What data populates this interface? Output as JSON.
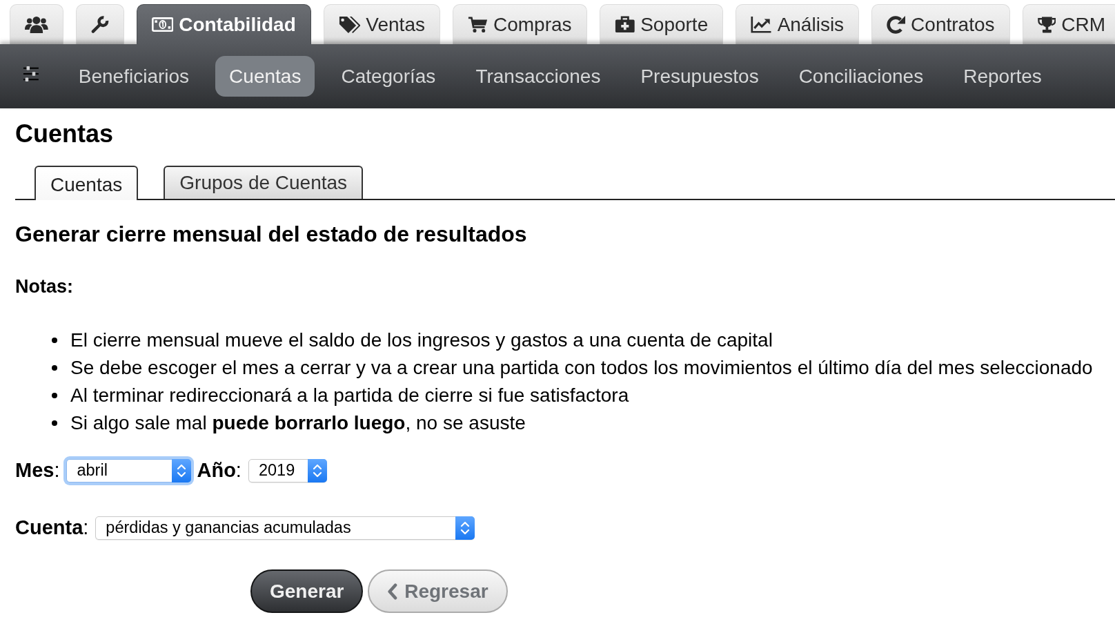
{
  "module_tabs": [
    {
      "selected": false
    },
    {
      "selected": false
    },
    {
      "label": "Contabilidad",
      "selected": true
    },
    {
      "label": "Ventas",
      "selected": false
    },
    {
      "label": "Compras",
      "selected": false
    },
    {
      "label": "Soporte",
      "selected": false
    },
    {
      "label": "Análisis",
      "selected": false
    },
    {
      "label": "Contratos",
      "selected": false
    },
    {
      "label": "CRM",
      "selected": false
    }
  ],
  "nav_items": [
    {
      "label": "Beneficiarios",
      "selected": false
    },
    {
      "label": "Cuentas",
      "selected": true
    },
    {
      "label": "Categorías",
      "selected": false
    },
    {
      "label": "Transacciones",
      "selected": false
    },
    {
      "label": "Presupuestos",
      "selected": false
    },
    {
      "label": "Conciliaciones",
      "selected": false
    },
    {
      "label": "Reportes",
      "selected": false
    }
  ],
  "page_title": "Cuentas",
  "sub_tabs": [
    {
      "label": "Cuentas",
      "selected": true
    },
    {
      "label": "Grupos de Cuentas",
      "selected": false
    }
  ],
  "section_title": "Generar cierre mensual del estado de resultados",
  "notes": {
    "title": "Notas:",
    "items": [
      "El cierre mensual mueve el saldo de los ingresos y gastos a una cuenta de capital",
      "Se debe escoger el mes a cerrar y va a crear una partida con todos los movimientos el último día del mes seleccionado",
      "Al terminar redireccionará a la partida de cierre si fue satisfactora",
      "Si algo sale mal **puede borrarlo luego**, no se asuste"
    ]
  },
  "form": {
    "rows": [
      {
        "fields": [
          {
            "label": "**Mes**:",
            "value": "abril",
            "focused": true
          },
          {
            "label": "**Año**:",
            "value": "2019",
            "focused": false
          }
        ]
      },
      {
        "fields": [
          {
            "label": "**Cuenta**:",
            "value": "pérdidas y ganancias acumuladas",
            "focused": false
          }
        ]
      }
    ]
  },
  "buttons": [
    {
      "kind": "primary",
      "label": "Generar"
    },
    {
      "kind": "back",
      "label": "Regresar"
    }
  ]
}
